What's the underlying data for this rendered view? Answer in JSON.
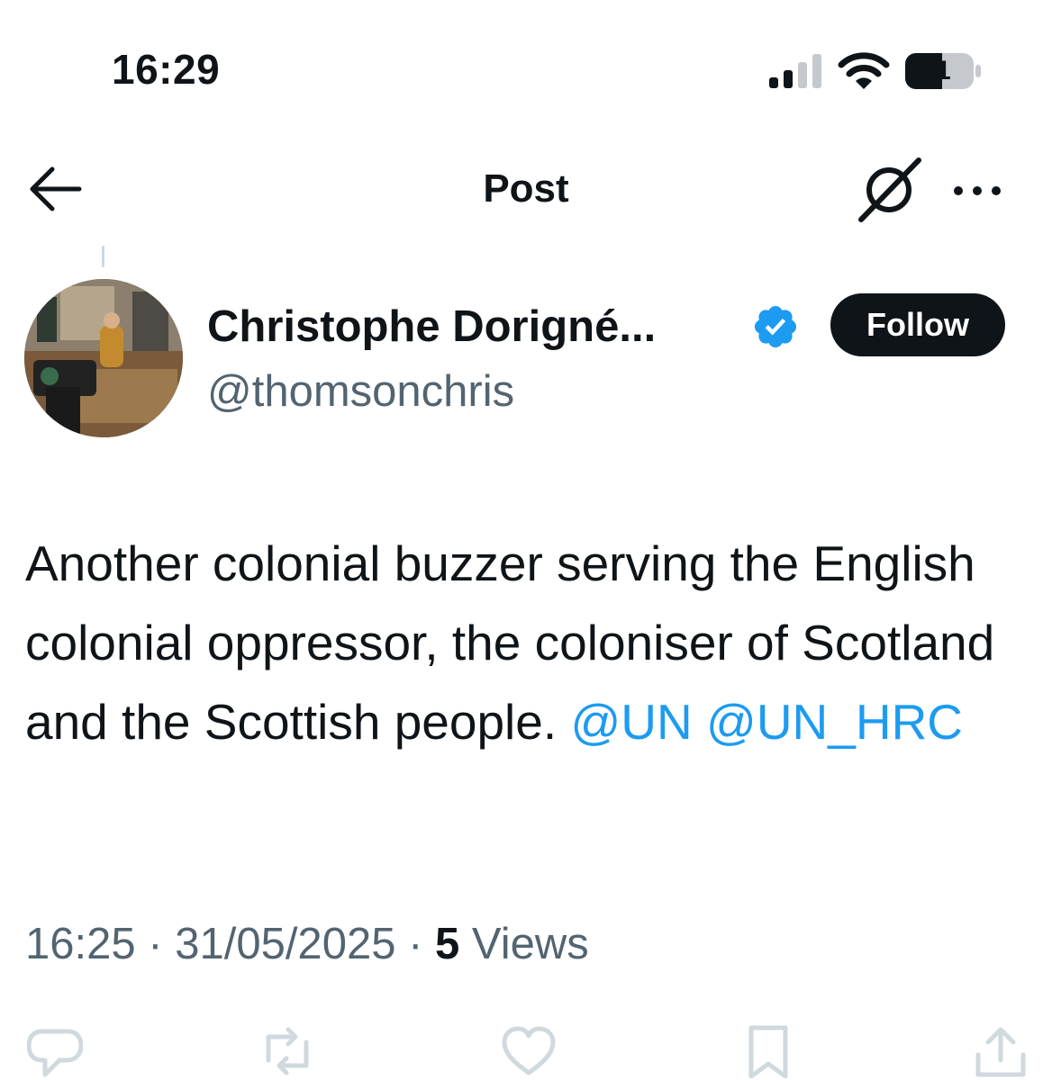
{
  "status_bar": {
    "time": "16:29",
    "battery": "51"
  },
  "header": {
    "title": "Post"
  },
  "author": {
    "display_name": "Christophe Dorigné...",
    "handle": "@thomsonchris",
    "verified": true,
    "follow_label": "Follow"
  },
  "post": {
    "text": "Another colonial buzzer serving the English colonial oppressor, the coloniser of Scotland and the Scottish people.",
    "mentions": [
      "@UN",
      "@UN_HRC"
    ],
    "time": "16:25",
    "date": "31/05/2025",
    "separator": "·",
    "views_count": "5",
    "views_label": "Views"
  },
  "actions": [
    "reply-icon",
    "repost-icon",
    "like-icon",
    "bookmark-icon",
    "share-icon"
  ],
  "colors": {
    "text": "#0f1419",
    "secondary": "#536471",
    "link": "#1d9bf0",
    "verified": "#1d9bf0",
    "follow_bg": "#0f1419",
    "action_icons": "#cfd9de"
  }
}
